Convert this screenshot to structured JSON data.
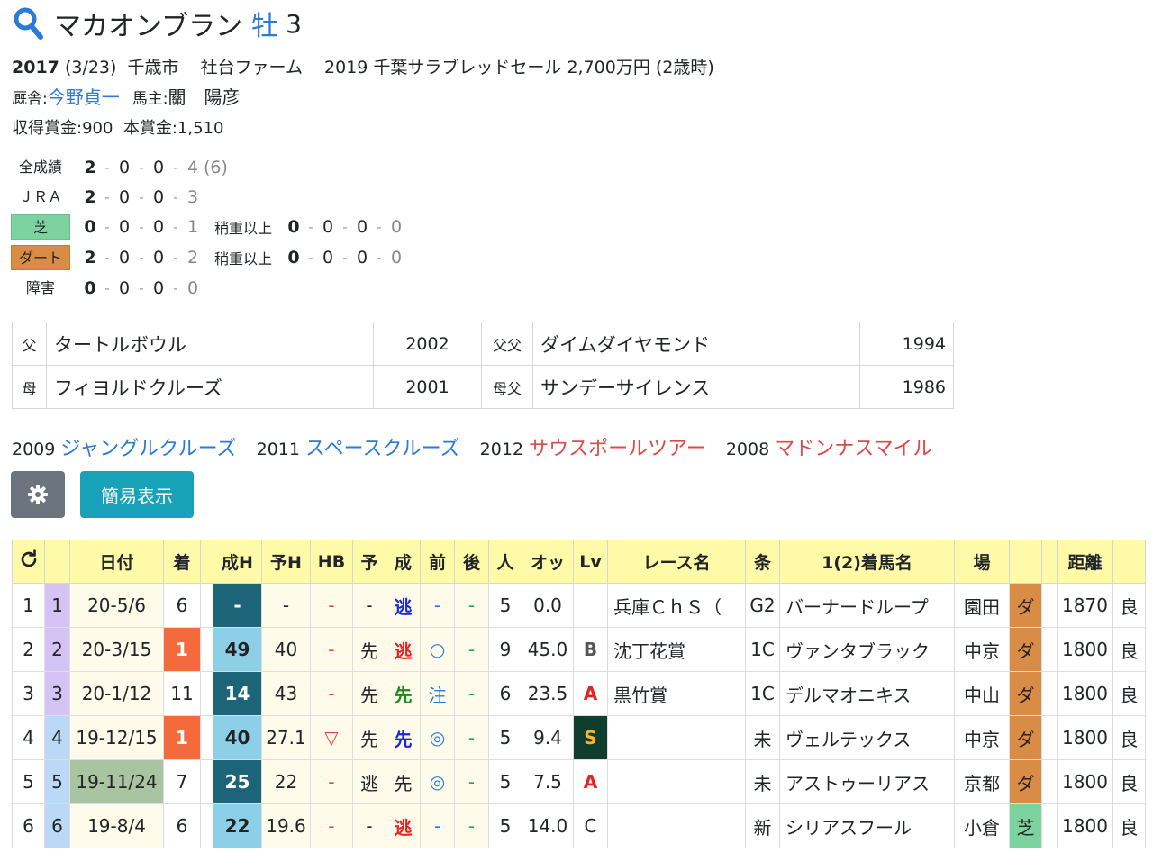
{
  "horse": {
    "name": "マカオンブラン",
    "sex": "牡",
    "age": "3"
  },
  "info": {
    "birth_year": "2017",
    "birth_date": "(3/23)",
    "birthplace": "千歳市",
    "breeder": "社台ファーム",
    "sale": "2019 千葉サラブレッドセール 2,700万円 (2歳時)"
  },
  "stable": {
    "trainer_label": "厩舎:",
    "trainer": "今野貞一",
    "owner_label": "馬主:",
    "owner": "關　陽彦"
  },
  "earnings": {
    "text": "収得賞金:900  本賞金:1,510"
  },
  "records": {
    "all": {
      "label": "全成績",
      "nums": [
        "2",
        "0",
        "0",
        "4"
      ],
      "extra": "(6)"
    },
    "jra": {
      "label": "ＪＲＡ",
      "nums": [
        "2",
        "0",
        "0",
        "3"
      ]
    },
    "turf": {
      "label": "芝",
      "nums": [
        "0",
        "0",
        "0",
        "1"
      ],
      "heavy_label": "稍重以上",
      "heavy": [
        "0",
        "0",
        "0",
        "0"
      ]
    },
    "dirt": {
      "label": "ダート",
      "nums": [
        "2",
        "0",
        "0",
        "2"
      ],
      "heavy_label": "稍重以上",
      "heavy": [
        "0",
        "0",
        "0",
        "0"
      ]
    },
    "jump": {
      "label": "障害",
      "nums": [
        "0",
        "0",
        "0",
        "0"
      ]
    }
  },
  "pedigree": {
    "sire": {
      "label": "父",
      "name": "タートルボウル",
      "year": "2002"
    },
    "sire_sire": {
      "label": "父父",
      "name": "ダイムダイヤモンド",
      "year": "1994"
    },
    "dam": {
      "label": "母",
      "name": "フィヨルドクルーズ",
      "year": "2001"
    },
    "dam_sire": {
      "label": "母父",
      "name": "サンデーサイレンス",
      "year": "1986"
    }
  },
  "siblings": [
    {
      "year": "2009",
      "name": "ジャングルクルーズ",
      "color": "#2a7bd6"
    },
    {
      "year": "2011",
      "name": "スペースクルーズ",
      "color": "#2a7bd6"
    },
    {
      "year": "2012",
      "name": "サウスポールツアー",
      "color": "#e04848"
    },
    {
      "year": "2008",
      "name": "マドンナスマイル",
      "color": "#e04848"
    }
  ],
  "buttons": {
    "settings_icon": "gear-icon",
    "simple_view": "簡易表示"
  },
  "table": {
    "headers": [
      "",
      "",
      "日付",
      "着",
      "",
      "成H",
      "予H",
      "HB",
      "予",
      "成",
      "前",
      "後",
      "人",
      "オッ",
      "Lv",
      "レース名",
      "条",
      "1(2)着馬名",
      "場",
      "",
      "",
      "距離",
      ""
    ],
    "rows": [
      {
        "no": "1",
        "g": "1",
        "date": "20-5/6",
        "place": "6",
        "sh": "-",
        "yh": "-",
        "hb": "-",
        "yo": "-",
        "sei": "逃",
        "mae": "-",
        "ato": "-",
        "pop": "5",
        "odds": "0.0",
        "lv": "",
        "race": "兵庫ＣｈＳ（",
        "cond": "G2",
        "horse": "バーナードループ",
        "track": "園田",
        "surf": "ダ",
        "dist": "1870",
        "going": "良"
      },
      {
        "no": "2",
        "g": "2",
        "date": "20-3/15",
        "place": "1",
        "sh": "49",
        "yh": "40",
        "hb": "-",
        "yo": "先",
        "sei": "逃",
        "mae": "○",
        "ato": "-",
        "pop": "9",
        "odds": "45.0",
        "lv": "B",
        "race": "沈丁花賞",
        "cond": "1C",
        "horse": "ヴァンタブラック",
        "track": "中京",
        "surf": "ダ",
        "dist": "1800",
        "going": "良"
      },
      {
        "no": "3",
        "g": "3",
        "date": "20-1/12",
        "place": "11",
        "sh": "14",
        "yh": "43",
        "hb": "-",
        "yo": "先",
        "sei": "先",
        "mae": "注",
        "ato": "-",
        "pop": "6",
        "odds": "23.5",
        "lv": "A",
        "race": "黒竹賞",
        "cond": "1C",
        "horse": "デルマオニキス",
        "track": "中山",
        "surf": "ダ",
        "dist": "1800",
        "going": "良"
      },
      {
        "no": "4",
        "g": "4",
        "date": "19-12/15",
        "place": "1",
        "sh": "40",
        "yh": "27.1",
        "hb": "▽",
        "yo": "先",
        "sei": "先",
        "mae": "◎",
        "ato": "-",
        "pop": "5",
        "odds": "9.4",
        "lv": "S",
        "race": "",
        "cond": "未",
        "horse": "ヴェルテックス",
        "track": "中京",
        "surf": "ダ",
        "dist": "1800",
        "going": "良"
      },
      {
        "no": "5",
        "g": "5",
        "date": "19-11/24",
        "place": "7",
        "sh": "25",
        "yh": "22",
        "hb": "-",
        "yo": "逃",
        "sei": "先",
        "mae": "◎",
        "ato": "-",
        "pop": "5",
        "odds": "7.5",
        "lv": "A",
        "race": "",
        "cond": "未",
        "horse": "アストゥーリアス",
        "track": "京都",
        "surf": "ダ",
        "dist": "1800",
        "going": "良"
      },
      {
        "no": "6",
        "g": "6",
        "date": "19-8/4",
        "place": "6",
        "sh": "22",
        "yh": "19.6",
        "hb": "-",
        "yo": "-",
        "sei": "逃",
        "mae": "-",
        "ato": "-",
        "pop": "5",
        "odds": "14.0",
        "lv": "C",
        "race": "",
        "cond": "新",
        "horse": "シリアスフール",
        "track": "小倉",
        "surf": "芝",
        "dist": "1800",
        "going": "良"
      }
    ]
  }
}
